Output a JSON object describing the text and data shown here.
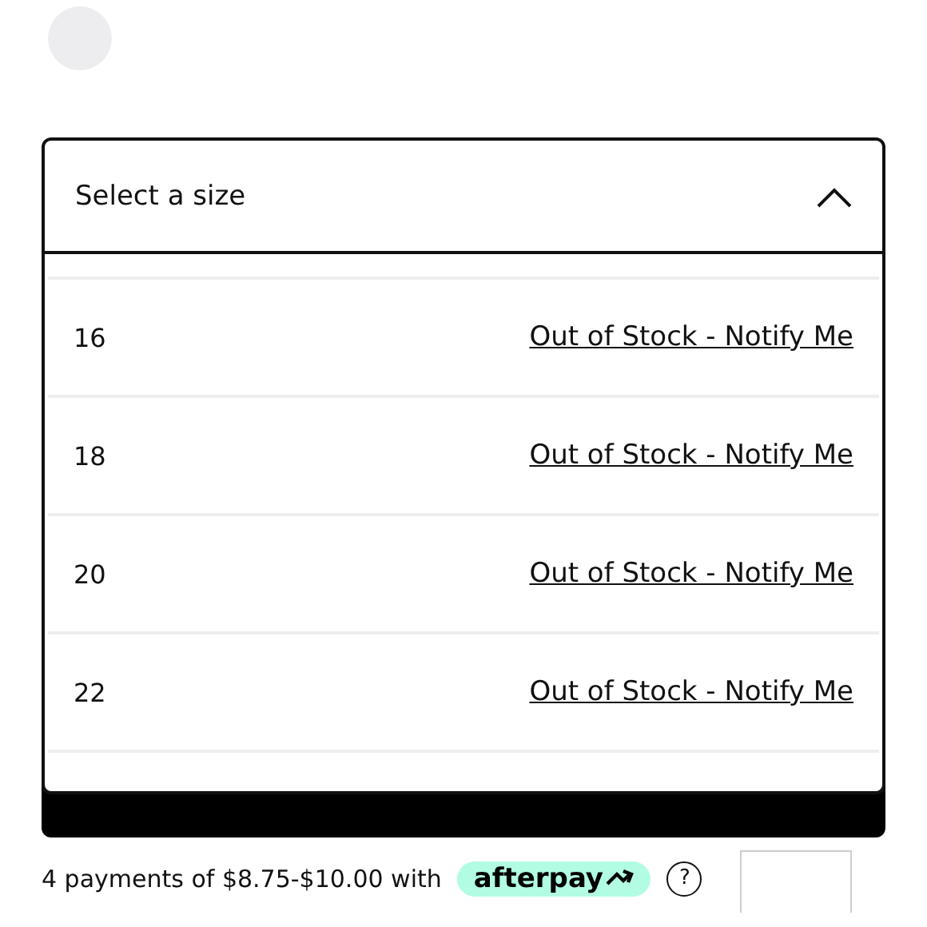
{
  "swatch": {
    "kind": "swatch"
  },
  "size_select": {
    "placeholder": "Select a size",
    "expanded": true
  },
  "size_options": [
    {
      "size": "16",
      "action": "Out of Stock - Notify Me"
    },
    {
      "size": "18",
      "action": "Out of Stock - Notify Me"
    },
    {
      "size": "20",
      "action": "Out of Stock - Notify Me"
    },
    {
      "size": "22",
      "action": "Out of Stock - Notify Me"
    }
  ],
  "payment": {
    "text": "4 payments of $8.75-$10.00 with",
    "badge": "afterpay",
    "help": "?"
  }
}
